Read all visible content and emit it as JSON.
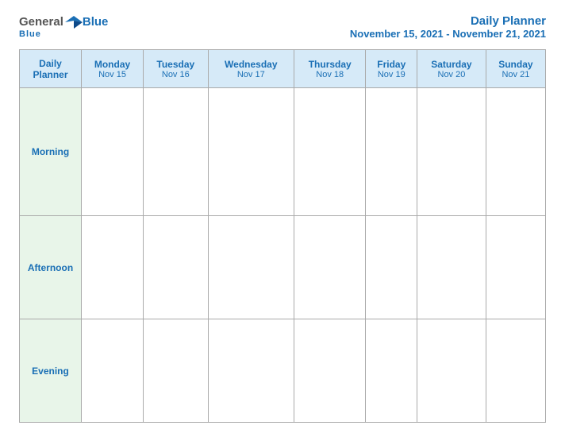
{
  "logo": {
    "general": "General",
    "blue": "Blue",
    "sub": "Blue"
  },
  "title": {
    "main": "Daily Planner",
    "date_range": "November 15, 2021 - November 21, 2021"
  },
  "columns": [
    {
      "id": "label",
      "name": "Daily\nPlanner",
      "date": ""
    },
    {
      "id": "mon",
      "name": "Monday",
      "date": "Nov 15"
    },
    {
      "id": "tue",
      "name": "Tuesday",
      "date": "Nov 16"
    },
    {
      "id": "wed",
      "name": "Wednesday",
      "date": "Nov 17"
    },
    {
      "id": "thu",
      "name": "Thursday",
      "date": "Nov 18"
    },
    {
      "id": "fri",
      "name": "Friday",
      "date": "Nov 19"
    },
    {
      "id": "sat",
      "name": "Saturday",
      "date": "Nov 20"
    },
    {
      "id": "sun",
      "name": "Sunday",
      "date": "Nov 21"
    }
  ],
  "rows": [
    {
      "id": "morning",
      "label": "Morning"
    },
    {
      "id": "afternoon",
      "label": "Afternoon"
    },
    {
      "id": "evening",
      "label": "Evening"
    }
  ]
}
